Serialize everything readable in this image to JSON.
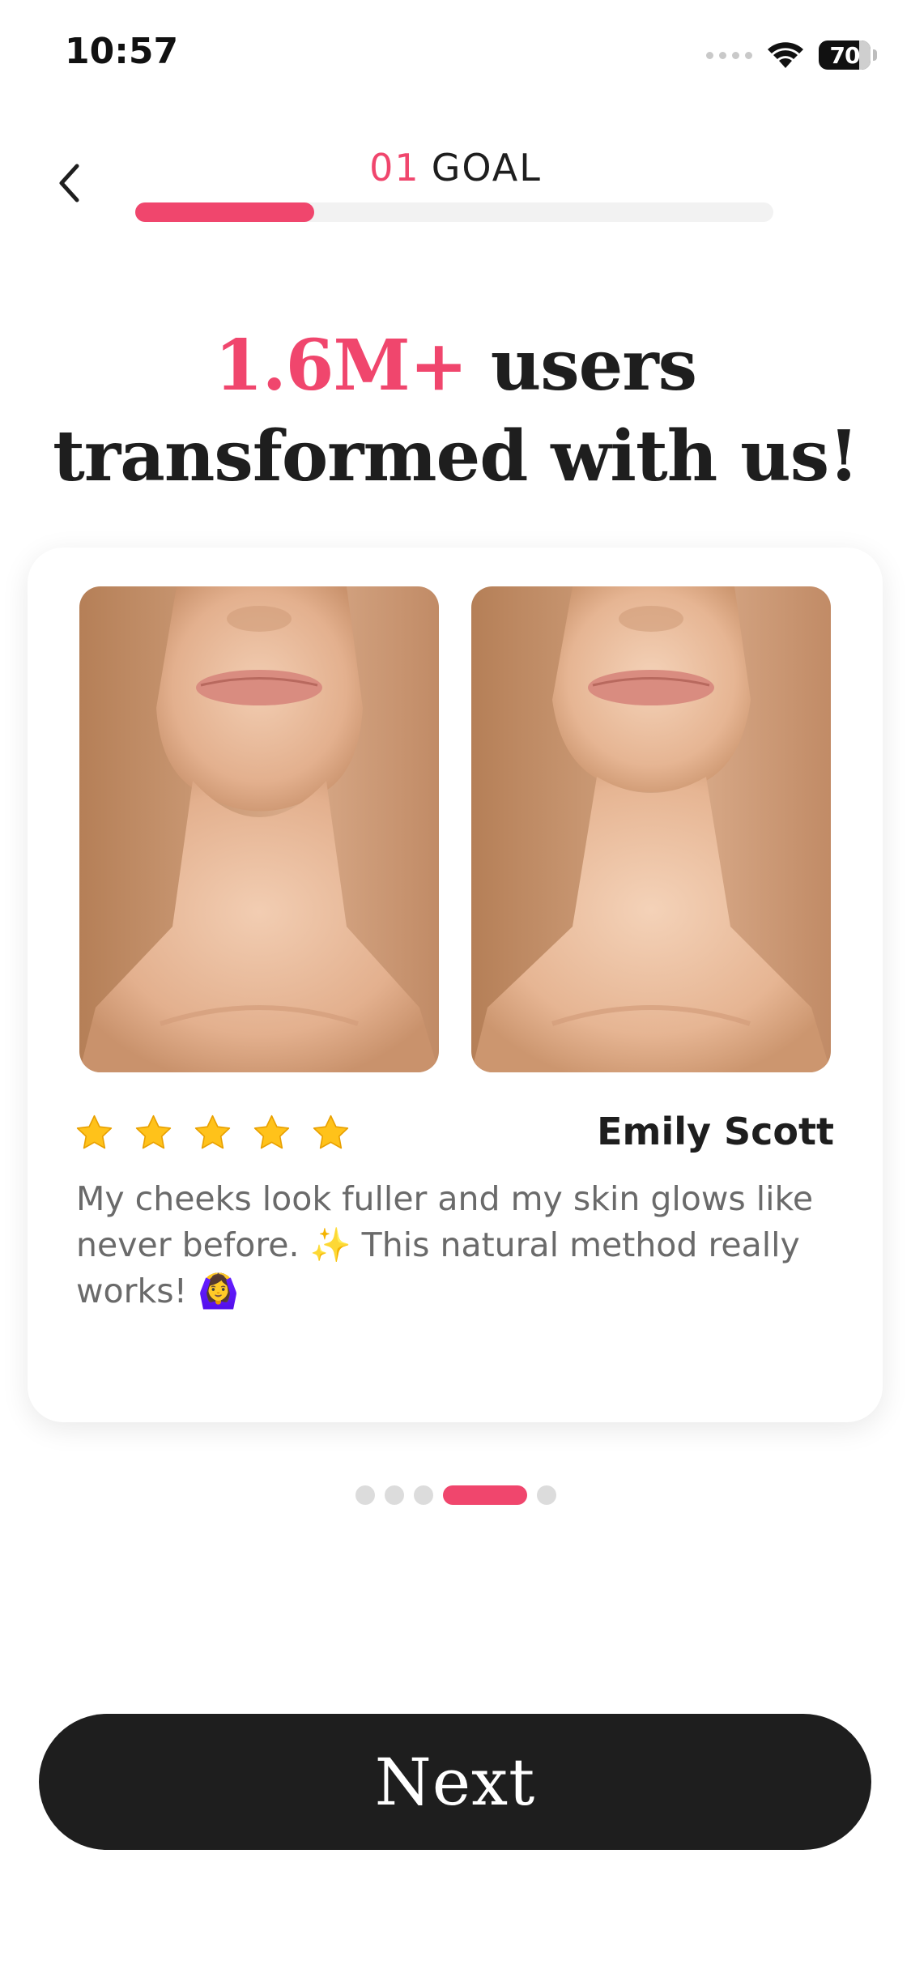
{
  "status_bar": {
    "time": "10:57",
    "battery": "70"
  },
  "header": {
    "step_number": "01",
    "step_name": "GOAL",
    "progress_fraction": 0.28
  },
  "headline": {
    "highlight": "1.6M+",
    "line1_rest": " users",
    "line2": "transformed with us!"
  },
  "testimonial": {
    "rating": 5,
    "reviewer": "Emily Scott",
    "text": "My cheeks look fuller and my skin glows like never before. ✨  This natural method really works! 🙆‍♀️"
  },
  "pagination": {
    "total": 5,
    "active_index": 3
  },
  "next_label": "Next",
  "colors": {
    "accent": "#f0466d",
    "dark": "#1e1e1e",
    "star": "#ffc21a"
  }
}
